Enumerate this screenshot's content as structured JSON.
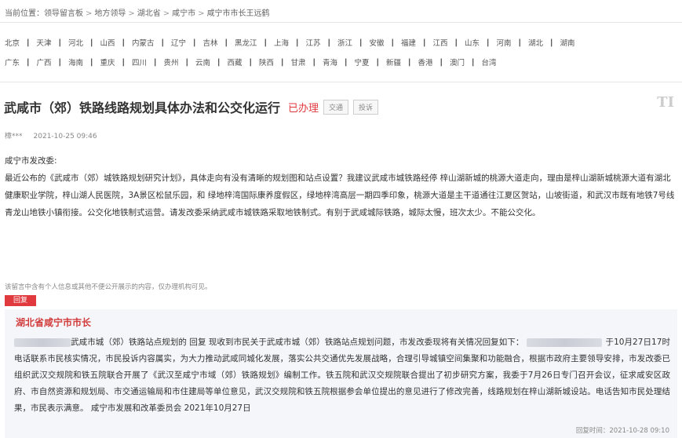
{
  "breadcrumb": {
    "prefix": "当前位置：",
    "items": [
      "领导留言板",
      "地方领导",
      "湖北省",
      "咸宁市",
      "咸宁市市长王远鹤"
    ],
    "separator": ">"
  },
  "regions": {
    "row1": [
      "北京",
      "天津",
      "河北",
      "山西",
      "内蒙古",
      "辽宁",
      "吉林",
      "黑龙江",
      "上海",
      "江苏",
      "浙江",
      "安徽",
      "福建",
      "江西",
      "山东",
      "河南",
      "湖北",
      "湖南"
    ],
    "row2": [
      "广东",
      "广西",
      "海南",
      "重庆",
      "四川",
      "贵州",
      "云南",
      "西藏",
      "陕西",
      "甘肃",
      "青海",
      "宁夏",
      "新疆",
      "香港",
      "澳门",
      "台湾"
    ]
  },
  "message": {
    "title": "武咸市（郊）铁路线路规划具体办法和公交化运行",
    "status": "已办理",
    "button_follow": "交通",
    "button_complain": "投诉",
    "font_toggle": "TI",
    "author": "樟***",
    "time": "2021-10-25 09:46",
    "greeting": "咸宁市发改委:",
    "body": "最近公布的《武咸市（郊）城铁路规划研究计划》，具体走向有没有清晰的规划图和站点设置？我建议武咸市城铁路经停 梓山湖新城的桃源大道走向，理由是梓山湖新城桃源大道有湖北健康职业学院，梓山湖人民医院，3A景区松鼠乐园，和 绿地梓湾国际康养度假区，绿地梓湾高层一期四季印象，桃源大道是主干道通往江夏区贺站，山坡街道，和武汉市既有地铁7号线青龙山地铁小镇衔接。公交化地铁制式运营。请发改委采纳武咸市城铁路采取地铁制式。有别于武咸城际铁路，城际太慢，班次太少。不能公交化。",
    "disclaimer": "该留言中含有个人信息或其他不便公开展示的内容，仅办理机构可见。"
  },
  "reply": {
    "tag": "回复",
    "from": "湖北省咸宁市市长",
    "text_a": "武咸市城（郊）铁路站点规划的 回复 现收到市民关于武咸市城（郊）铁路站点规划问题，市发改委现将有关情况回复如下：",
    "text_b": "于10月27日17时电话联系市民核实情况，市民投诉内容属实，为大力推动武咸同城化发展，落实公共交通优先发展战略，合理引导城镇空间集聚和功能融合，根据市政府主要领导安排，市发改委已组织武汉交规院和铁五院联合开展了《武汉至咸宁市域（郊）铁路规划》编制工作。铁五院和武汉交规院联合提出了初步研究方案，我委于7月26日专门召开会议，征求咸安区政府、市自然资源和规划局、市交通运输局和市住建局等单位意见，武汉交规院和铁五院根据参会单位提出的意见进行了修改完善，线路规划在梓山湖新城设站。电话告知市民处理结果，市民表示满意。 咸宁市发展和改革委员会 2021年10月27日",
    "time": "回复时间：2021-10-28 09:10"
  },
  "colors": {
    "accent_red": "#e0393e",
    "reply_bg": "#f5f6fa"
  }
}
